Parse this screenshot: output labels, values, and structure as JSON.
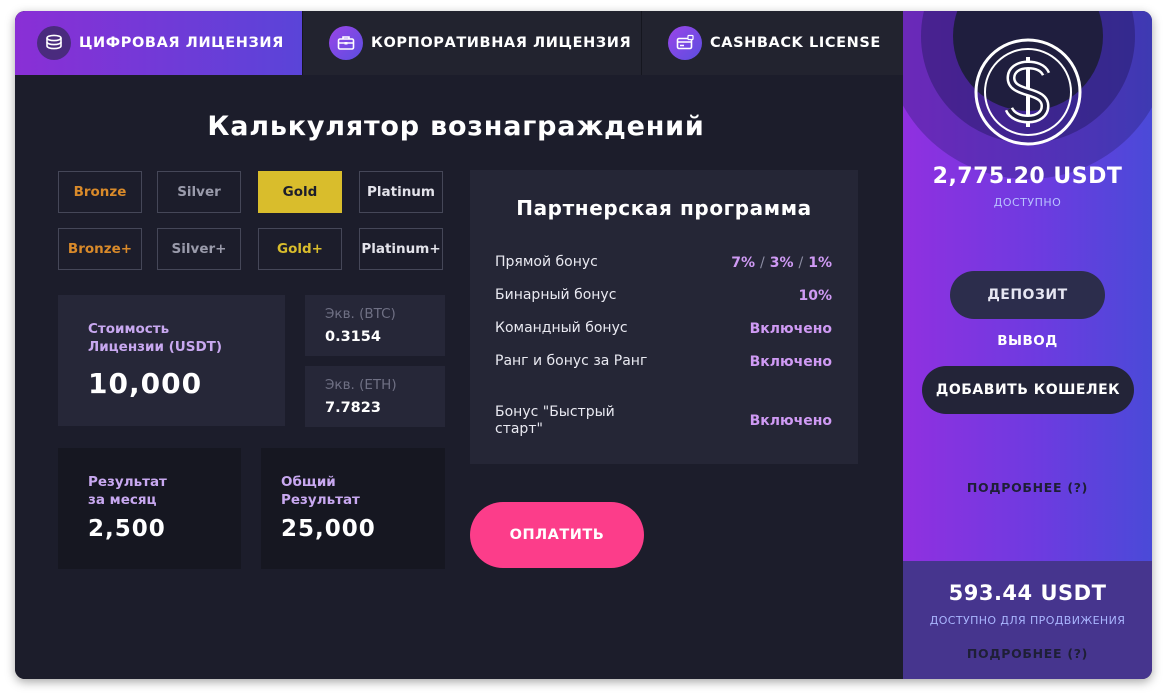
{
  "tabs": [
    {
      "label": "ЦИФРОВАЯ ЛИЦЕНЗИЯ",
      "icon": "coins-icon",
      "active": true
    },
    {
      "label": "КОРПОРАТИВНАЯ ЛИЦЕНЗИЯ",
      "icon": "briefcase-icon",
      "active": false
    },
    {
      "label": "CASHBACK LICENSE",
      "icon": "card-icon",
      "active": false
    }
  ],
  "calculator": {
    "title": "Калькулятор вознаграждений",
    "tiers": [
      {
        "label": "Bronze",
        "color": "#d98a2a",
        "active": false
      },
      {
        "label": "Silver",
        "color": "#9a9bab",
        "active": false
      },
      {
        "label": "Gold",
        "color": "#1c1d2b",
        "active": true
      },
      {
        "label": "Platinum",
        "color": "#e3e3ea",
        "active": false
      },
      {
        "label": "Bronze+",
        "color": "#d98a2a",
        "active": false
      },
      {
        "label": "Silver+",
        "color": "#9a9bab",
        "active": false
      },
      {
        "label": "Gold+",
        "color": "#d9bd2c",
        "active": false
      },
      {
        "label": "Platinum+",
        "color": "#e3e3ea",
        "active": false
      }
    ],
    "license_cost": {
      "label": "Стоимость Лицензии (USDT)",
      "value": "10,000"
    },
    "btc": {
      "label": "Экв. (BTC)",
      "value": "0.3154"
    },
    "eth": {
      "label": "Экв. (ETH)",
      "value": "7.7823"
    },
    "monthly": {
      "label": "Результат за месяц",
      "value": "2,500"
    },
    "total": {
      "label": "Общий Результат",
      "value": "25,000"
    },
    "pay_label": "ОПЛАТИТЬ"
  },
  "partner": {
    "title": "Партнерская программа",
    "rows": [
      {
        "label": "Прямой бонус",
        "values": [
          "7%",
          "3%",
          "1%"
        ]
      },
      {
        "label": "Бинарный бонус",
        "value": "10%"
      },
      {
        "label": "Командный бонус",
        "value": "Включено"
      },
      {
        "label": "Ранг и бонус за Ранг",
        "value": "Включено"
      },
      {
        "label": "Бонус \"Быстрый старт\"",
        "value": "Включено"
      }
    ],
    "separator": "/"
  },
  "sidebar": {
    "coin_icon": "dollar-coin-icon",
    "balance": "2,775.20 USDT",
    "available_label": "ДОСТУПНО",
    "deposit_label": "ДЕПОЗИТ",
    "withdraw_label": "ВЫВОД",
    "add_wallet_label": "ДОБАВИТЬ КОШЕЛЕК",
    "more_label": "ПОДРОБНЕЕ (?)",
    "promo_balance": "593.44 USDT",
    "promo_available_label": "ДОСТУПНО ДЛЯ ПРОДВИЖЕНИЯ",
    "promo_more_label": "ПОДРОБНЕЕ (?)"
  },
  "colors": {
    "accent": "#fc3d8a",
    "gold": "#d9bd2c",
    "purple_text": "#cf9af4",
    "background": "#1c1d2b"
  }
}
